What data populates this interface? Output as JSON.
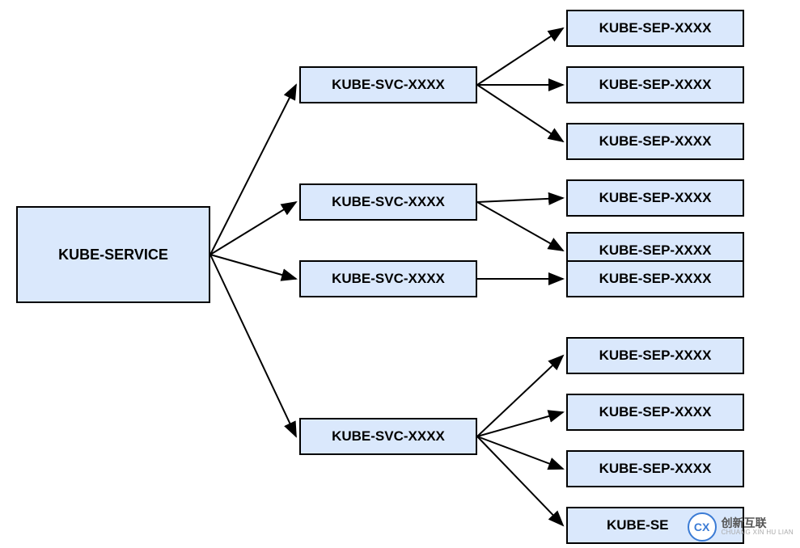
{
  "root": {
    "label": "KUBE-SERVICE"
  },
  "svc": [
    {
      "label": "KUBE-SVC-XXXX"
    },
    {
      "label": "KUBE-SVC-XXXX"
    },
    {
      "label": "KUBE-SVC-XXXX"
    },
    {
      "label": "KUBE-SVC-XXXX"
    }
  ],
  "sep": [
    {
      "label": "KUBE-SEP-XXXX"
    },
    {
      "label": "KUBE-SEP-XXXX"
    },
    {
      "label": "KUBE-SEP-XXXX"
    },
    {
      "label": "KUBE-SEP-XXXX"
    },
    {
      "label": "KUBE-SEP-XXXX"
    },
    {
      "label": "KUBE-SEP-XXXX"
    },
    {
      "label": "KUBE-SEP-XXXX"
    },
    {
      "label": "KUBE-SEP-XXXX"
    },
    {
      "label": "KUBE-SEP-XXXX"
    },
    {
      "label": "KUBE-SE"
    }
  ],
  "watermark": {
    "logo_inner": "CX",
    "line1": "创新互联",
    "line2": "CHUANG XIN HU LIAN"
  }
}
